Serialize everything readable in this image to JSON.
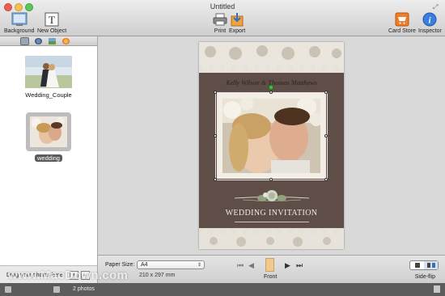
{
  "window": {
    "title": "Untitled"
  },
  "toolbar": {
    "background": "Background",
    "new_object": "New Object",
    "print": "Print",
    "export": "Export",
    "card_store": "Card Store",
    "inspector": "Inspector"
  },
  "sidebar": {
    "tabs": [
      {
        "icon": "photo-library-icon",
        "selected": true
      },
      {
        "icon": "globe-icon",
        "selected": false
      },
      {
        "icon": "image-icon",
        "selected": false
      },
      {
        "icon": "flower-icon",
        "selected": false
      }
    ],
    "photos": [
      {
        "name": "Wedding_Couple",
        "selected": false
      },
      {
        "name": "wedding",
        "selected": true
      }
    ],
    "drag_hint": "Drag your photos here",
    "add_label": "+",
    "remove_label": "−"
  },
  "card": {
    "names": "Kelly Wilson & Thomas Matthews",
    "title": "WEDDING INVITATION"
  },
  "bottom": {
    "paper_size_label": "Paper Size:",
    "paper_size_value": "A4",
    "paper_dims": "210 x 297 mm",
    "page_label": "Front",
    "sideflip_label": "Side-flip"
  },
  "status": {
    "text": "2 photos",
    "watermark": "www.MacDown.com"
  },
  "colors": {
    "card_background": "#5f4d48",
    "lace": "#e8e3da",
    "selection_handle_rotate": "#3bc43b"
  }
}
